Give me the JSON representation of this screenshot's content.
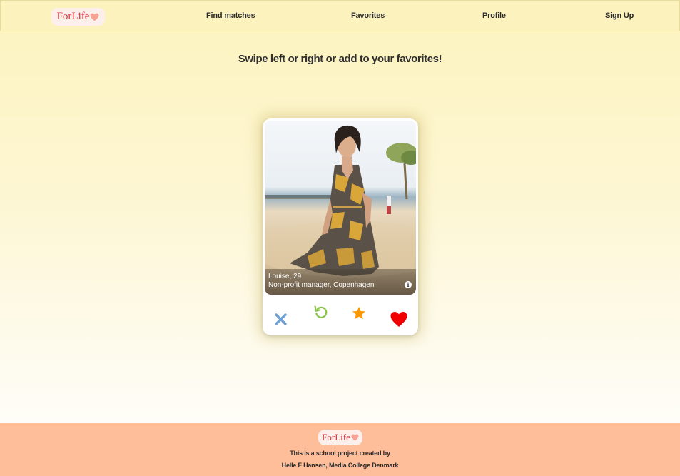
{
  "header": {
    "logo_text": "ForLife",
    "nav": [
      {
        "label": "Find matches"
      },
      {
        "label": "Favorites"
      },
      {
        "label": "Profile"
      },
      {
        "label": "Sign Up"
      }
    ]
  },
  "main": {
    "headline": "Swipe left or right or add to your favorites!",
    "card": {
      "name_age": "Louise, 29",
      "occupation_location": "Non-profit manager, Copenhagen",
      "info_icon": "info-icon",
      "actions": [
        {
          "icon": "close-icon",
          "color": "#6fa1d4"
        },
        {
          "icon": "undo-icon",
          "color": "#8bc34a"
        },
        {
          "icon": "star-icon",
          "color": "#ff9800"
        },
        {
          "icon": "heart-icon",
          "color": "#f00000"
        }
      ]
    }
  },
  "footer": {
    "logo_text": "ForLife",
    "line1": "This is a school project created by",
    "line2": "Helle F Hansen, Media College Denmark"
  },
  "colors": {
    "brand_red": "#d9343b",
    "header_bg": "#fcf2be",
    "footer_bg": "#ffbe9a"
  }
}
